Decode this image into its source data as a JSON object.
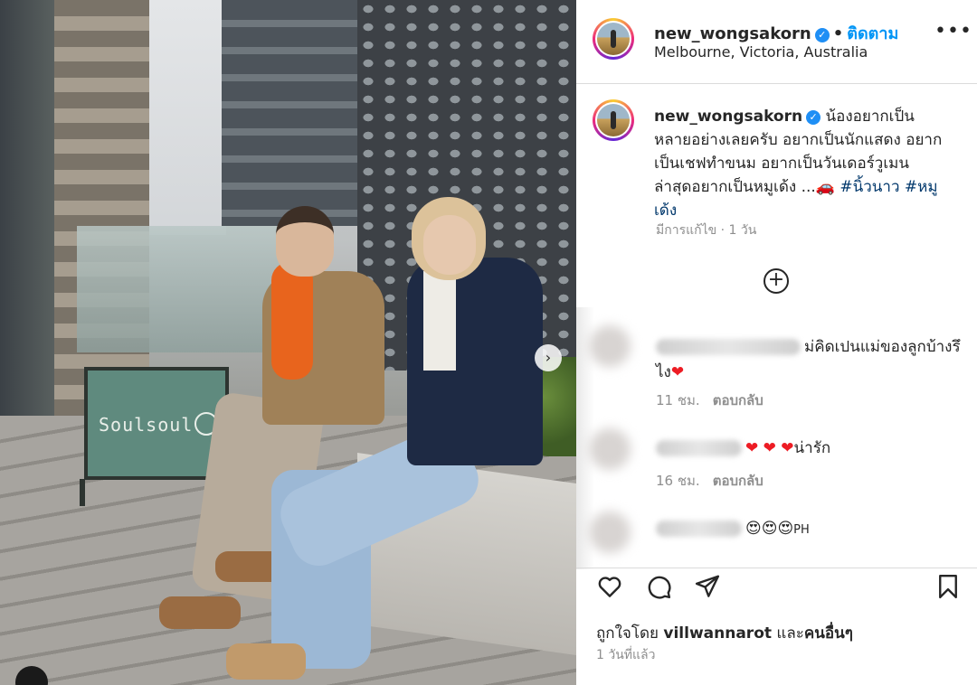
{
  "post": {
    "username": "new_wongsakorn",
    "follow_label": "ติดตาม",
    "separator": "•",
    "location": "Melbourne, Victoria, Australia",
    "more_label": "•••",
    "caption_text": "น้องอยากเป็นหลายอย่างเลยครับ อยากเป็นนักแสดง อยากเป็นเชฟทำขนม อยากเป็นวันเดอร์วูเมน ล่าสุดอยากเป็นหมูเด้ง ...",
    "caption_emoji": "🚗",
    "hashtag_1": "#นิ้วนาว",
    "hashtag_2": "#หมูเด้ง",
    "edited_label": "มีการแก้ไข · 1 วัน",
    "load_more_symbol": "+"
  },
  "photo": {
    "sign_text": "Soulsoul",
    "next_symbol": "›"
  },
  "comments": [
    {
      "text": "ม่คิดเปนแม่ของลูกบ้างรึไง",
      "emoji": "❤",
      "time": "11 ชม.",
      "reply": "ตอบกลับ"
    },
    {
      "emoji": "❤ ❤ ❤",
      "text": "น่ารัก",
      "time": "16 ชม.",
      "reply": "ตอบกลับ"
    },
    {
      "emoji": "😍😍😍",
      "text": "PH"
    }
  ],
  "actions": {
    "liked_by_prefix": "ถูกใจโดย",
    "liked_by_user": "villwannarot",
    "liked_by_and": "และ",
    "liked_by_others": "คนอื่นๆ",
    "time_ago": "1 วันที่แล้ว"
  },
  "colors": {
    "link_blue": "#0095f6",
    "hashtag_blue": "#00376b",
    "verified_blue": "#1f8ff5",
    "heart_red": "#ed1c24",
    "muted_gray": "#8e8e8e"
  }
}
